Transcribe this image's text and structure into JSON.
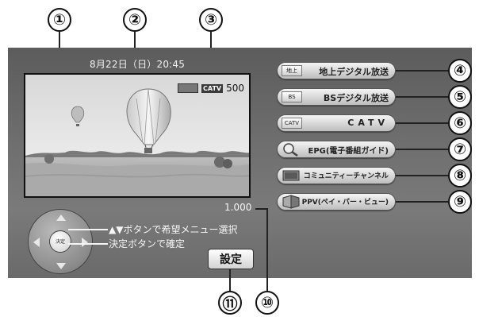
{
  "header": {
    "datetime": "8月22日（日）20:45"
  },
  "preview": {
    "badge_tag": "CATV",
    "channel": "500"
  },
  "menu": {
    "items": [
      {
        "icon": "地上",
        "label": "地上デジタル放送"
      },
      {
        "icon": "BS",
        "label": "BSデジタル放送"
      },
      {
        "icon": "CATV",
        "label": "CATV"
      },
      {
        "icon": "magnifier-icon",
        "label": "EPG(電子番組ガイド)"
      },
      {
        "icon": "community-icon",
        "label": "コミュニティーチャンネル"
      },
      {
        "icon": "ppv-icon",
        "label": "PPV(ペイ・パー・ビュー)"
      }
    ]
  },
  "help": {
    "line1": "▲▼ボタンで希望メニュー選択",
    "line2": "決定ボタンで確定",
    "dpad_center": "決定"
  },
  "scale": "1.000",
  "settings_button": "設定",
  "callouts": [
    "①",
    "②",
    "③",
    "④",
    "⑤",
    "⑥",
    "⑦",
    "⑧",
    "⑨",
    "⑩",
    "⑪"
  ],
  "colors": {
    "panel": "#6e6e6e",
    "button_face": "#d6d6d6",
    "text_light": "#f2f2f2"
  }
}
